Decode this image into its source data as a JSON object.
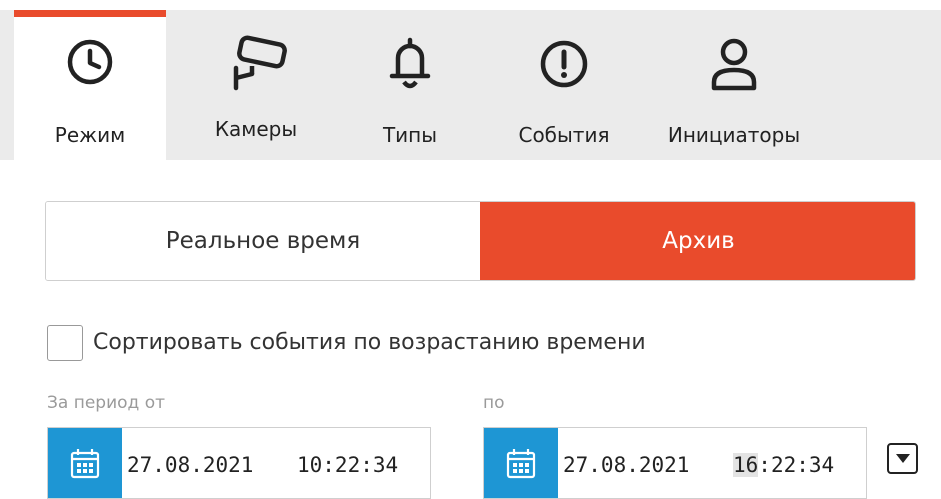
{
  "tabs": [
    {
      "label": "Режим",
      "icon": "clock-icon"
    },
    {
      "label": "Камеры",
      "icon": "camera-icon"
    },
    {
      "label": "Типы",
      "icon": "bell-icon"
    },
    {
      "label": "События",
      "icon": "alert-circle-icon"
    },
    {
      "label": "Инициаторы",
      "icon": "user-icon"
    }
  ],
  "mode": {
    "realtime": "Реальное время",
    "archive": "Архив",
    "selected": "Архив"
  },
  "sort": {
    "label": "Сортировать события по возрастанию времени",
    "checked": false
  },
  "period": {
    "from_label": "За период от",
    "to_label": "по",
    "from_date": "27.08.2021",
    "from_time": "10:22:34",
    "to_date": "27.08.2021",
    "to_time_highlight": "16",
    "to_time_rest": ":22:34"
  },
  "colors": {
    "accent": "#e94b2c",
    "calendar": "#1e96d4",
    "tabbar": "#ebebeb"
  }
}
